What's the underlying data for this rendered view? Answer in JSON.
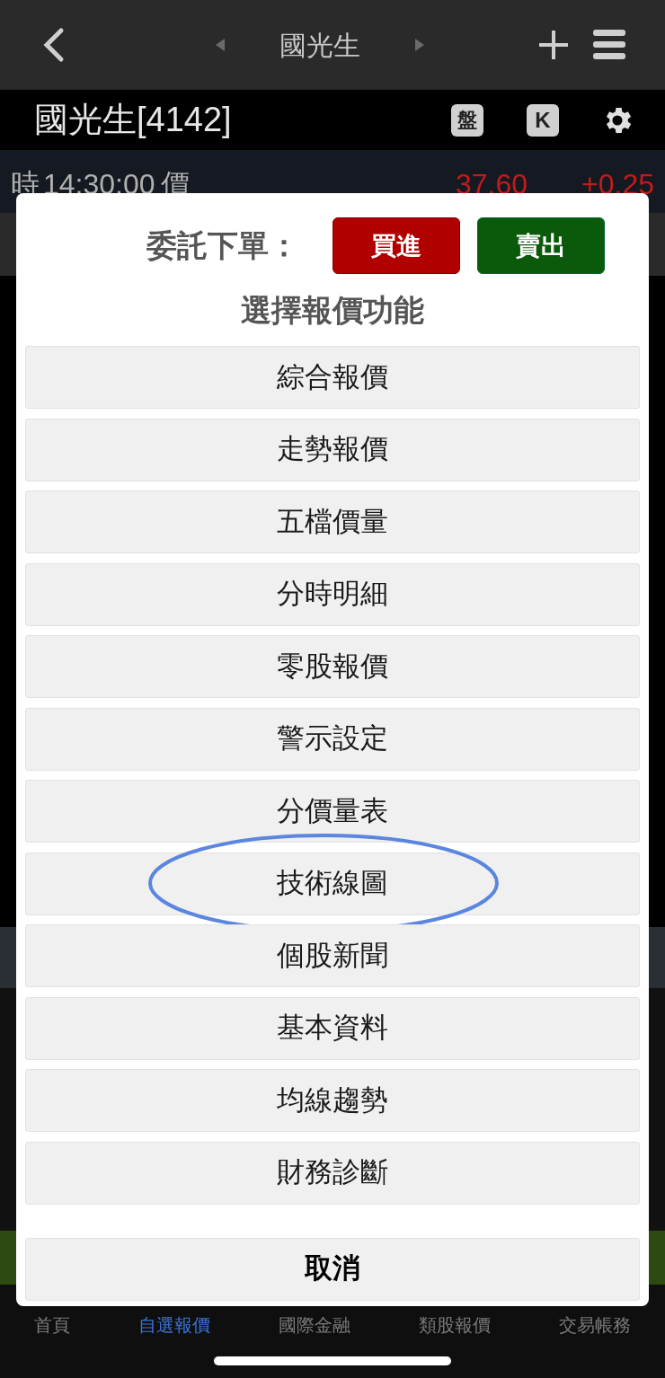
{
  "top_bar": {
    "title": "國光生"
  },
  "stock_header": {
    "name": "國光生[4142]",
    "badge": "盤",
    "k_badge": "K"
  },
  "price_row": {
    "time_label": "時",
    "time": "14:30:00",
    "price_label": "價",
    "price": "37.60",
    "change": "+0.25"
  },
  "order_dialog": {
    "order_label": "委託下單：",
    "buy_button": "買進",
    "sell_button": "賣出",
    "title": "選擇報價功能",
    "options": [
      {
        "label": "綜合報價",
        "highlighted": false
      },
      {
        "label": "走勢報價",
        "highlighted": false
      },
      {
        "label": "五檔價量",
        "highlighted": false
      },
      {
        "label": "分時明細",
        "highlighted": false
      },
      {
        "label": "零股報價",
        "highlighted": false
      },
      {
        "label": "警示設定",
        "highlighted": false
      },
      {
        "label": "分價量表",
        "highlighted": false
      },
      {
        "label": "技術線圖",
        "highlighted": true
      },
      {
        "label": "個股新聞",
        "highlighted": false
      },
      {
        "label": "基本資料",
        "highlighted": false
      },
      {
        "label": "均線趨勢",
        "highlighted": false
      },
      {
        "label": "財務診斷",
        "highlighted": false
      }
    ],
    "cancel_button": "取消"
  },
  "tab_bar": [
    {
      "label": "首頁",
      "selected": false
    },
    {
      "label": "自選報價",
      "selected": true
    },
    {
      "label": "國際金融",
      "selected": false
    },
    {
      "label": "類股報價",
      "selected": false
    },
    {
      "label": "交易帳務",
      "selected": false
    }
  ]
}
